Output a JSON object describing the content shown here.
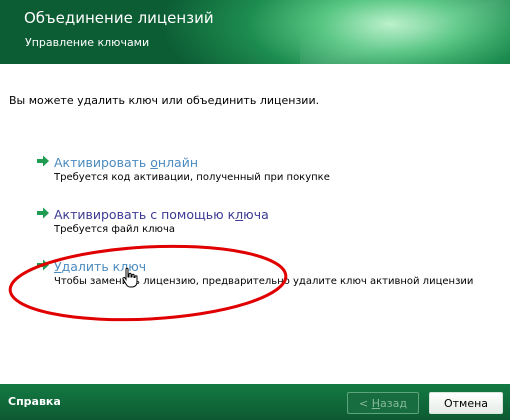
{
  "header": {
    "title": "Объединение лицензий",
    "subtitle": "Управление ключами"
  },
  "main": {
    "info_text": "Вы можете удалить ключ или объединить лицензии.",
    "options": [
      {
        "label_pre": "Активировать ",
        "label_u": "о",
        "label_post": "нлайн",
        "description": "Требуется код активации, полученный при покупке"
      },
      {
        "label_pre": "Активировать с помощью к",
        "label_u": "л",
        "label_post": "юча",
        "description": "Требуется файл ключа"
      },
      {
        "label_pre": "",
        "label_u": "У",
        "label_post": "далить ключ",
        "description": "Чтобы заменить лицензию, предварительно удалите ключ активной лицензии"
      }
    ]
  },
  "footer": {
    "help_label": "Справка",
    "back_prefix": "< ",
    "back_u": "Н",
    "back_rest": "азад",
    "cancel_label": "Отмена"
  },
  "icons": {
    "arrow": "green-arrow-icon",
    "cursor": "hand-cursor-icon"
  },
  "colors": {
    "header_green": "#1d8c4f",
    "link": "#3c3a91",
    "link_visited": "#4b8bbf",
    "annotation": "#e00000"
  }
}
